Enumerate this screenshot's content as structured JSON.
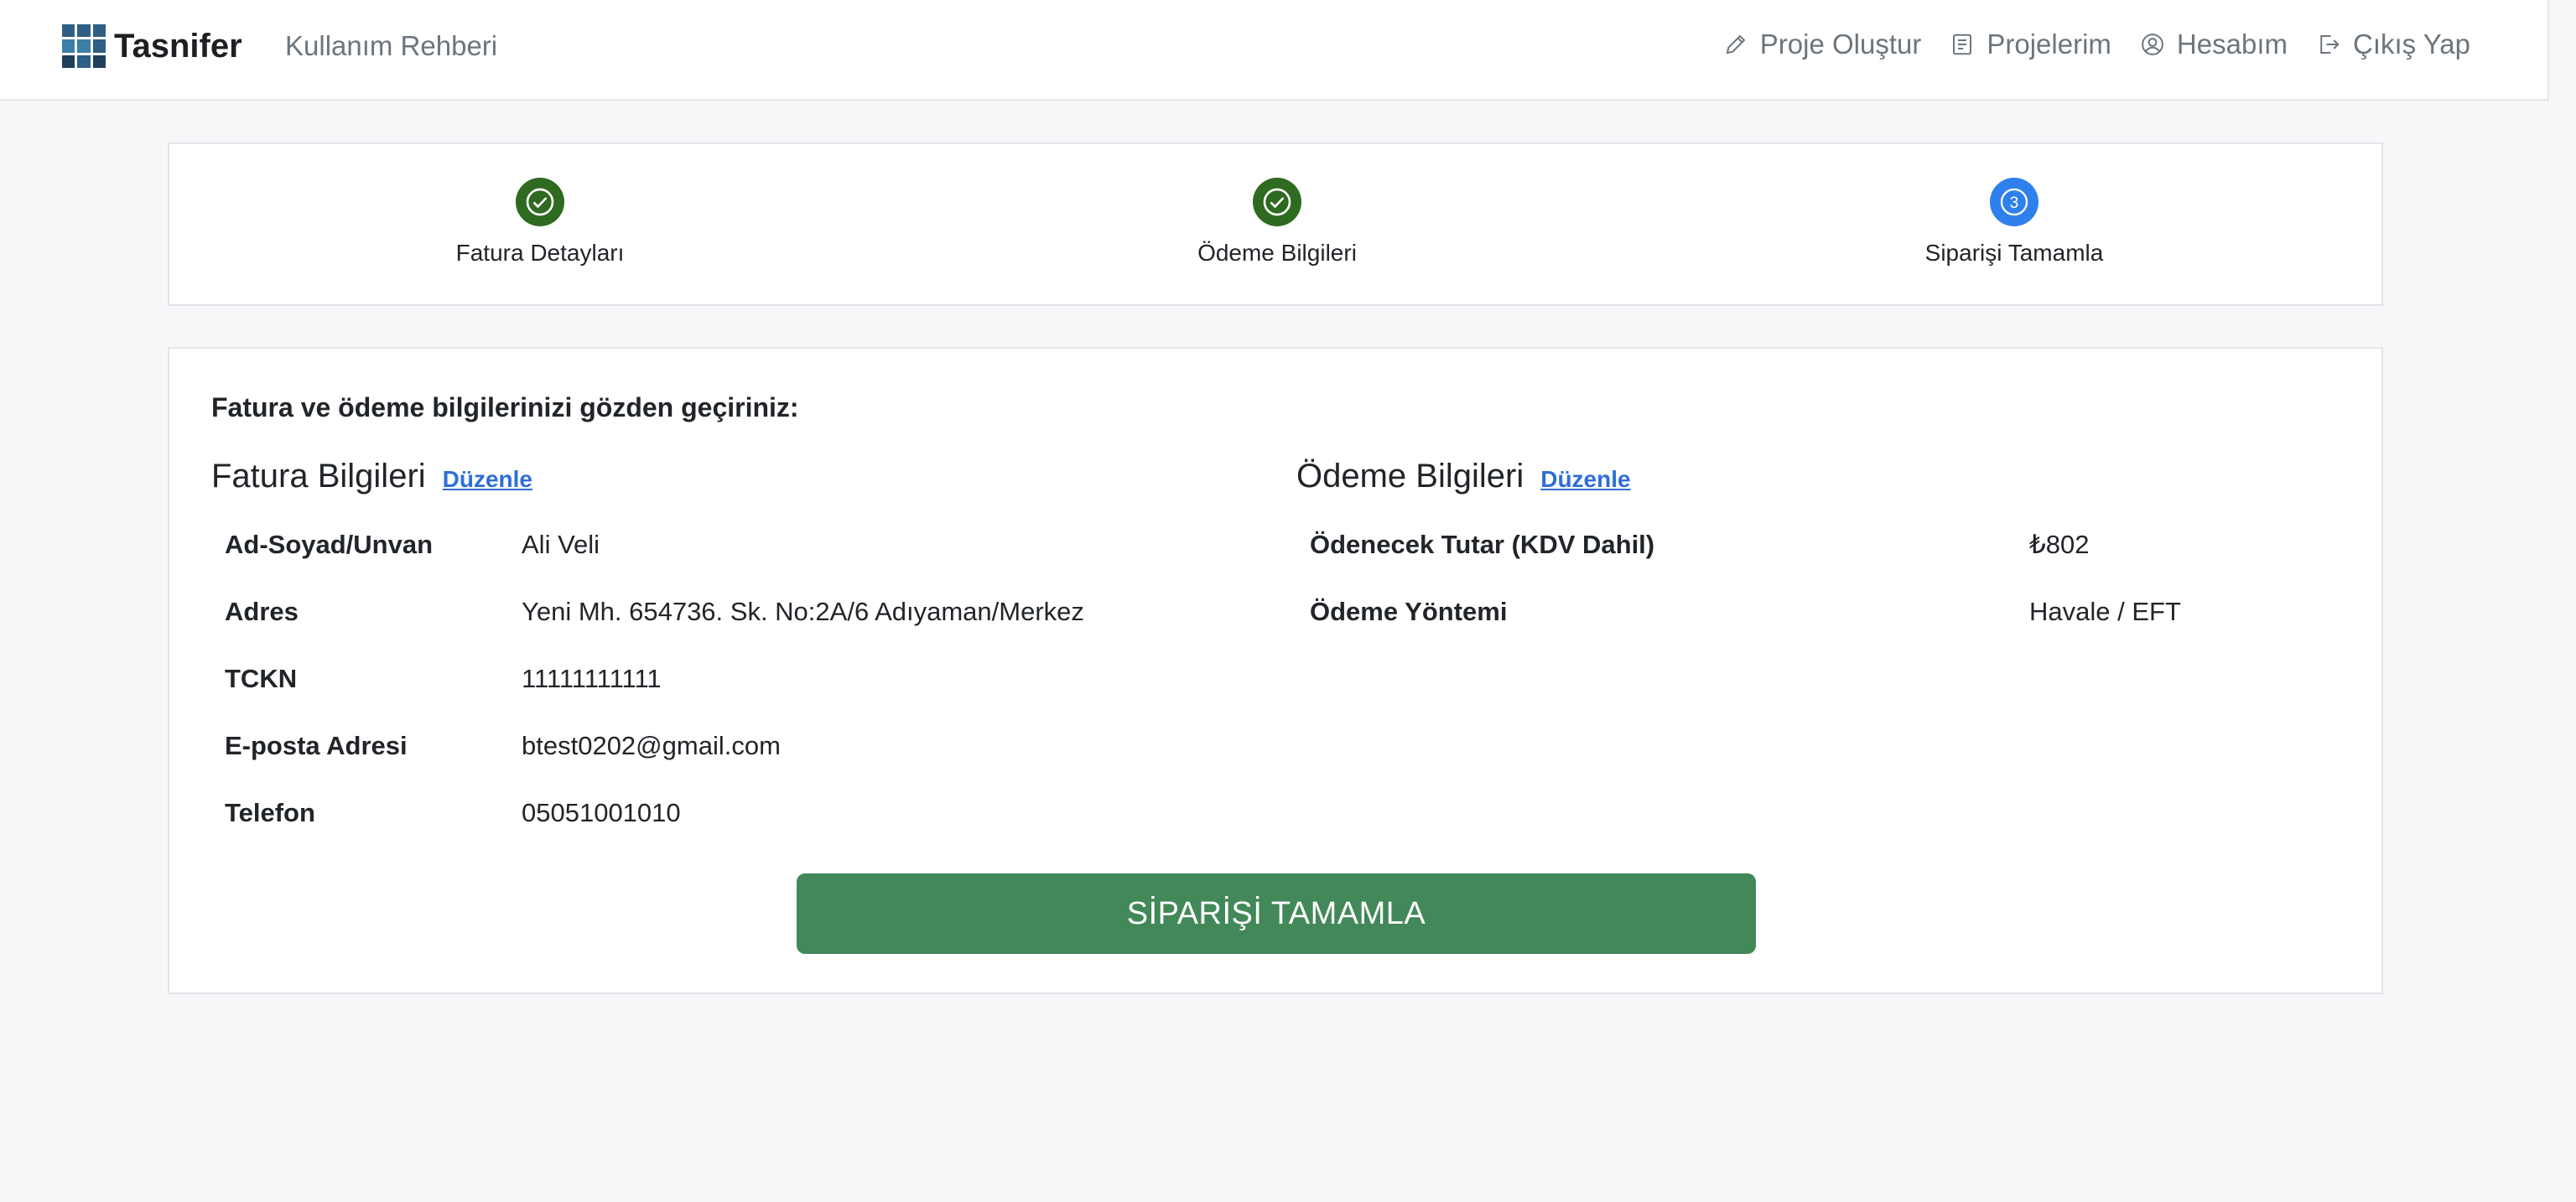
{
  "navbar": {
    "brand": "Tasnifer",
    "guide": "Kullanım Rehberi",
    "items": [
      {
        "label": "Proje Oluştur",
        "icon": "pencil-icon"
      },
      {
        "label": "Projelerim",
        "icon": "document-icon"
      },
      {
        "label": "Hesabım",
        "icon": "user-circle-icon"
      },
      {
        "label": "Çıkış Yap",
        "icon": "logout-icon"
      }
    ]
  },
  "steps": [
    {
      "label": "Fatura Detayları",
      "state": "done"
    },
    {
      "label": "Ödeme Bilgileri",
      "state": "done"
    },
    {
      "label": "Siparişi Tamamla",
      "state": "active",
      "number": "3"
    }
  ],
  "review": {
    "heading": "Fatura ve ödeme bilgilerinizi gözden geçiriniz:",
    "invoice": {
      "title": "Fatura Bilgileri",
      "edit": "Düzenle",
      "rows": [
        {
          "label": "Ad-Soyad/Unvan",
          "value": "Ali Veli"
        },
        {
          "label": "Adres",
          "value": "Yeni Mh. 654736. Sk. No:2A/6 Adıyaman/Merkez"
        },
        {
          "label": "TCKN",
          "value": "11111111111"
        },
        {
          "label": "E-posta Adresi",
          "value": "btest0202@gmail.com"
        },
        {
          "label": "Telefon",
          "value": "05051001010"
        }
      ]
    },
    "payment": {
      "title": "Ödeme Bilgileri",
      "edit": "Düzenle",
      "rows": [
        {
          "label": "Ödenecek Tutar (KDV Dahil)",
          "value": "₺802"
        },
        {
          "label": "Ödeme Yöntemi",
          "value": "Havale / EFT"
        }
      ]
    },
    "submit_label": "SİPARİŞİ TAMAMLA"
  },
  "colors": {
    "done": "#2e6a1f",
    "active": "#2f80ed",
    "submit": "#428859",
    "link": "#2f6fd6"
  }
}
